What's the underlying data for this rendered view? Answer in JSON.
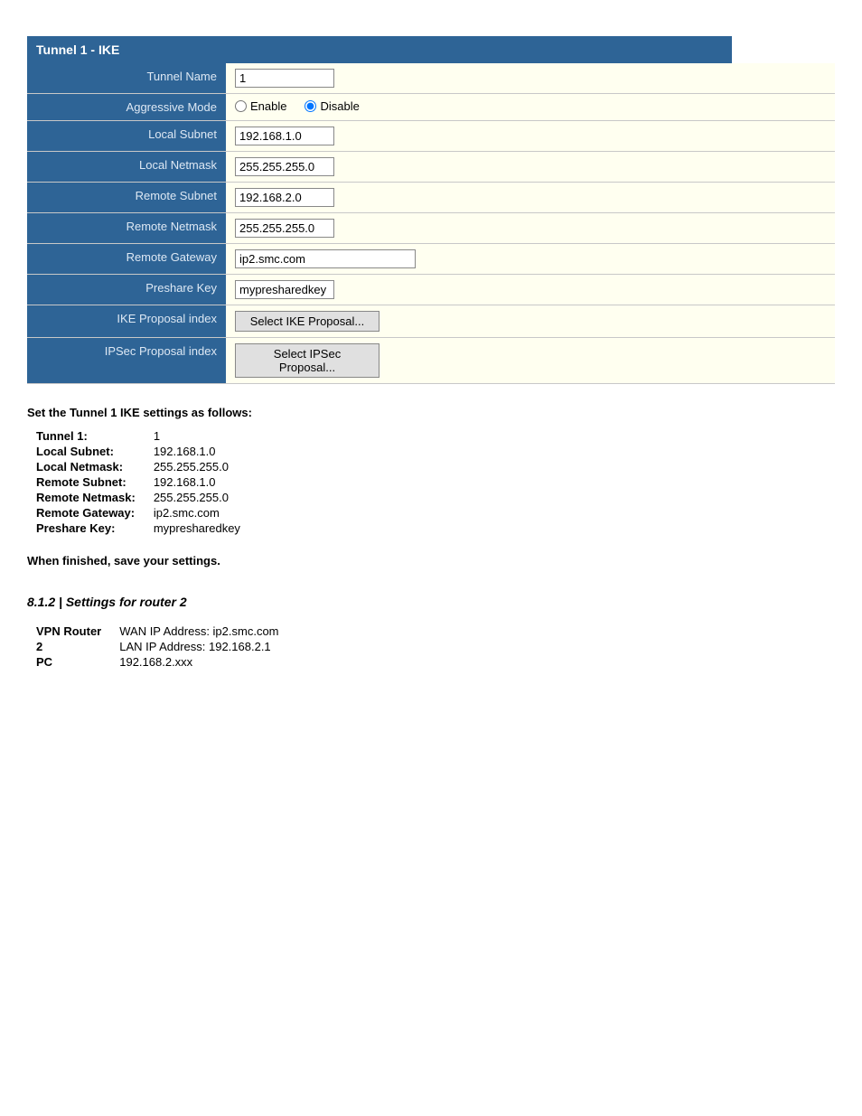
{
  "tunnel": {
    "header": "Tunnel 1 - IKE",
    "rows": [
      {
        "label": "Tunnel Name",
        "type": "text",
        "value": "1",
        "inputClass": "narrow"
      },
      {
        "label": "Aggressive Mode",
        "type": "radio",
        "options": [
          "Enable",
          "Disable"
        ],
        "selected": "Disable"
      },
      {
        "label": "Local Subnet",
        "type": "text",
        "value": "192.168.1.0",
        "inputClass": "narrow"
      },
      {
        "label": "Local Netmask",
        "type": "text",
        "value": "255.255.255.0",
        "inputClass": "narrow"
      },
      {
        "label": "Remote Subnet",
        "type": "text",
        "value": "192.168.2.0",
        "inputClass": "narrow"
      },
      {
        "label": "Remote Netmask",
        "type": "text",
        "value": "255.255.255.0",
        "inputClass": "narrow"
      },
      {
        "label": "Remote Gateway",
        "type": "text",
        "value": "ip2.smc.com",
        "inputClass": "wide"
      },
      {
        "label": "Preshare Key",
        "type": "text",
        "value": "mypresharedkey",
        "inputClass": "narrow"
      },
      {
        "label": "IKE Proposal index",
        "type": "button",
        "buttonLabel": "Select IKE Proposal..."
      },
      {
        "label": "IPSec Proposal index",
        "type": "button",
        "buttonLabel": "Select IPSec Proposal..."
      }
    ]
  },
  "instructions": {
    "intro": "Set the Tunnel 1 IKE settings as follows:",
    "details": [
      {
        "label": "Tunnel 1:",
        "value": "1"
      },
      {
        "label": "Local Subnet:",
        "value": "192.168.1.0"
      },
      {
        "label": "Local Netmask:",
        "value": "255.255.255.0"
      },
      {
        "label": "Remote Subnet:",
        "value": "192.168.1.0"
      },
      {
        "label": "Remote Netmask:",
        "value": "255.255.255.0"
      },
      {
        "label": "Remote Gateway:",
        "value": "ip2.smc.com"
      },
      {
        "label": "Preshare Key:",
        "value": "mypresharedkey"
      }
    ],
    "finish": "When finished, save your settings."
  },
  "section2": {
    "heading": "8.1.2 | Settings for router 2",
    "vpn_rows": [
      {
        "label": "VPN Router",
        "value": "WAN IP Address: ip2.smc.com"
      },
      {
        "label": "2",
        "value": "LAN IP Address: 192.168.2.1"
      },
      {
        "label": "PC",
        "value": "192.168.2.xxx"
      }
    ]
  }
}
